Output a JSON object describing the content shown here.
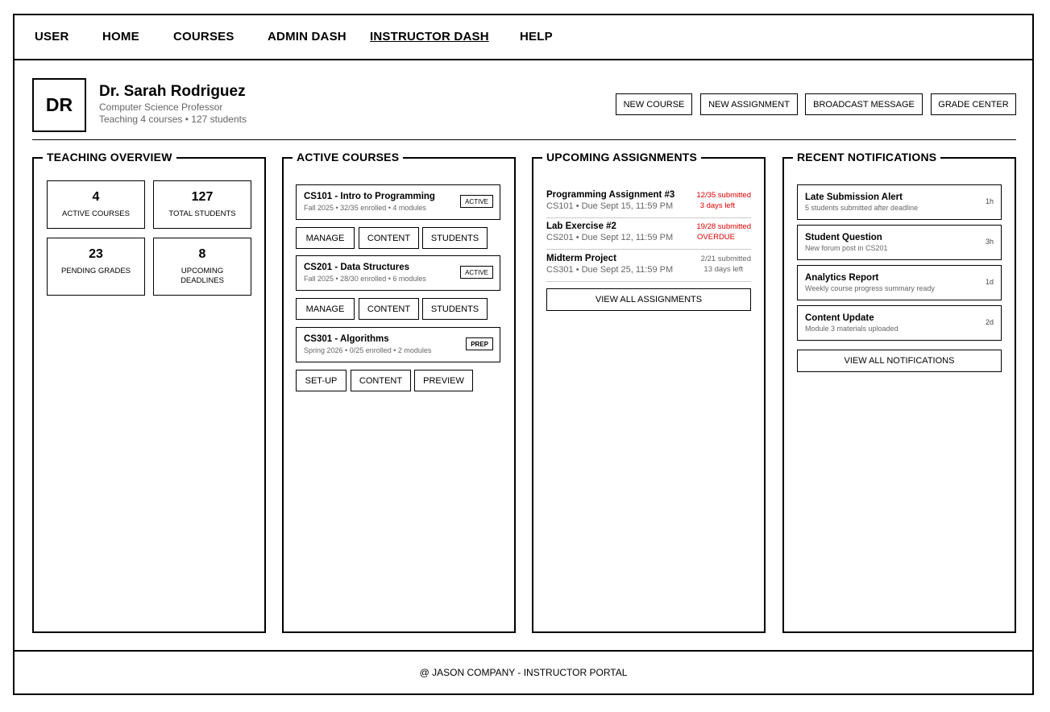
{
  "nav": {
    "items": [
      {
        "label": "USER"
      },
      {
        "label": "HOME"
      },
      {
        "label": "COURSES"
      },
      {
        "label": "ADMIN DASH"
      },
      {
        "label": "INSTRUCTOR DASH",
        "active": true
      },
      {
        "label": "HELP"
      }
    ]
  },
  "profile": {
    "initials": "DR",
    "name": "Dr. Sarah Rodriguez",
    "title": "Computer Science Professor",
    "stats": "Teaching 4 courses • 127 students"
  },
  "actions": {
    "new_course": "NEW COURSE",
    "new_assignment": "NEW ASSIGNMENT",
    "broadcast": "BROADCAST MESSAGE",
    "grade_center": "GRADE CENTER"
  },
  "overview": {
    "title": "TEACHING OVERVIEW",
    "stats": [
      {
        "value": "4",
        "label": "ACTIVE COURSES"
      },
      {
        "value": "127",
        "label": "TOTAL STUDENTS"
      },
      {
        "value": "23",
        "label": "PENDING GRADES"
      },
      {
        "value": "8",
        "label": "UPCOMING DEADLINES"
      }
    ]
  },
  "courses": {
    "title": "ACTIVE COURSES",
    "items": [
      {
        "name": "CS101 - Intro to Programming",
        "meta": "Fall 2025 • 32/35 enrolled • 4 modules",
        "badge": "ACTIVE",
        "buttons": [
          "MANAGE",
          "CONTENT",
          "STUDENTS"
        ]
      },
      {
        "name": "CS201 - Data Structures",
        "meta": "Fall 2025 • 28/30 enrolled • 6 modules",
        "badge": "ACTIVE",
        "buttons": [
          "MANAGE",
          "CONTENT",
          "STUDENTS"
        ]
      },
      {
        "name": "CS301 - Algorithms",
        "meta": "Spring 2026 • 0/25 enrolled • 2 modules",
        "badge": "PREP",
        "buttons": [
          "SET-UP",
          "CONTENT",
          "PREVIEW"
        ]
      }
    ]
  },
  "assignments": {
    "title": "UPCOMING ASSIGNMENTS",
    "items": [
      {
        "title": "Programming Assignment #3",
        "due": "CS101 • Due Sept 15, 11:59 PM",
        "submitted": "12/35 submitted",
        "status": "3 days left",
        "urgent": true
      },
      {
        "title": "Lab Exercise #2",
        "due": "CS201 • Due Sept 12, 11:59 PM",
        "submitted": "19/28 submitted",
        "status": "OVERDUE",
        "urgent": true
      },
      {
        "title": "Midterm Project",
        "due": "CS301 • Due Sept 25, 11:59 PM",
        "submitted": "2/21 submitted",
        "status": "13 days left",
        "urgent": false
      }
    ],
    "view_all": "VIEW ALL ASSIGNMENTS"
  },
  "notifications": {
    "title": "RECENT NOTIFICATIONS",
    "items": [
      {
        "title": "Late Submission Alert",
        "body": "5 students submitted after deadline",
        "time": "1h"
      },
      {
        "title": "Student Question",
        "body": "New forum post in CS201",
        "time": "3h"
      },
      {
        "title": "Analytics Report",
        "body": "Weekly course progress summary ready",
        "time": "1d"
      },
      {
        "title": "Content Update",
        "body": "Module 3 materials uploaded",
        "time": "2d"
      }
    ],
    "view_all": "VIEW ALL NOTIFICATIONS"
  },
  "footer": {
    "text": "@ JASON COMPANY - INSTRUCTOR PORTAL"
  }
}
